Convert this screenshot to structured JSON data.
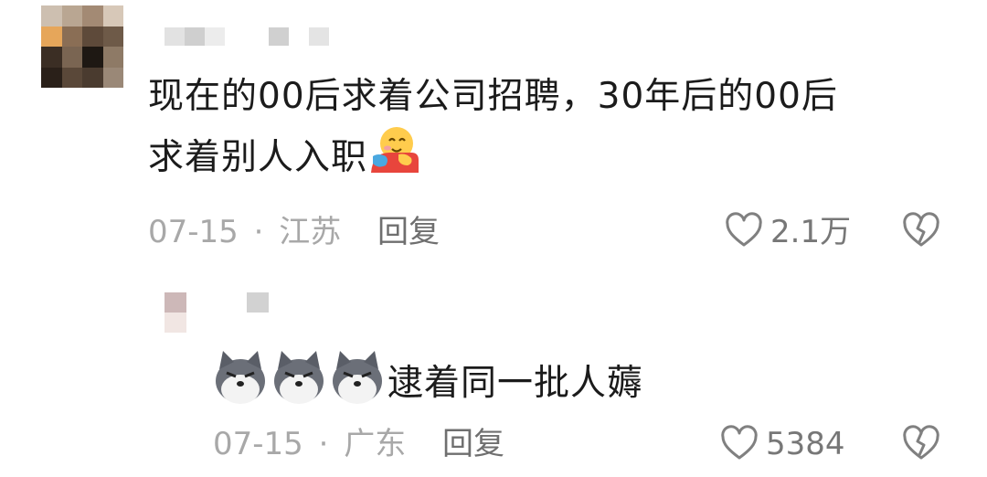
{
  "comment": {
    "text_line1": "现在的00后求着公司招聘，30年后的00后",
    "text_line2": "求着别人入职",
    "emoji": "hugging-face-emoji",
    "date": "07-15",
    "separator": "·",
    "location": "江苏",
    "reply_label": "回复",
    "like_count": "2.1万"
  },
  "reply": {
    "text": "逮着同一批人薅",
    "emoji": "husky-dog-emoji",
    "date": "07-15",
    "separator": "·",
    "location": "广东",
    "reply_label": "回复",
    "like_count": "5384"
  },
  "colors": {
    "text": "#1b1b1b",
    "meta": "#a8a8a8",
    "reply": "#6f6f6f",
    "icon": "#808080"
  },
  "icons": [
    "heart-outline-icon",
    "broken-heart-icon"
  ]
}
